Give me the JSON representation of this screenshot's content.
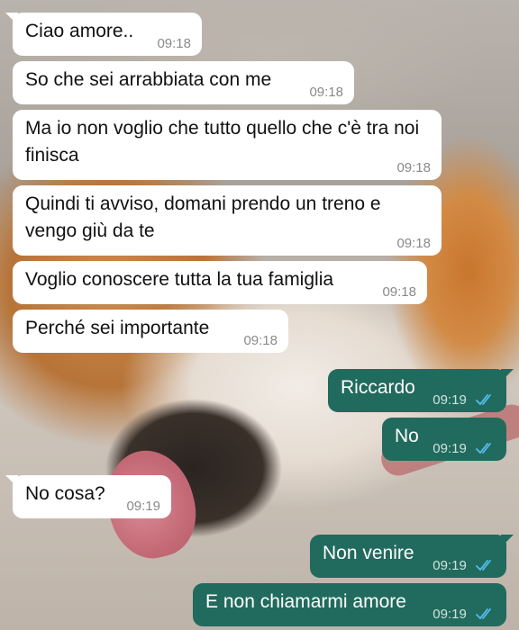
{
  "messages": [
    {
      "dir": "in",
      "text": "Ciao amore..",
      "time": "09:18"
    },
    {
      "dir": "in",
      "text": "So che sei arrabbiata con me",
      "time": "09:18"
    },
    {
      "dir": "in",
      "text": "Ma io non voglio che tutto quello che c'è tra noi finisca",
      "time": "09:18"
    },
    {
      "dir": "in",
      "text": "Quindi ti avviso, domani prendo un treno e vengo giù da te",
      "time": "09:18"
    },
    {
      "dir": "in",
      "text": "Voglio conoscere tutta la tua famiglia",
      "time": "09:18"
    },
    {
      "dir": "in",
      "text": "Perché sei importante",
      "time": "09:18"
    },
    {
      "dir": "out",
      "text": "Riccardo",
      "time": "09:19",
      "status": "read"
    },
    {
      "dir": "out",
      "text": "No",
      "time": "09:19",
      "status": "read"
    },
    {
      "dir": "in",
      "text": "No cosa?",
      "time": "09:19"
    },
    {
      "dir": "out",
      "text": "Non venire",
      "time": "09:19",
      "status": "read"
    },
    {
      "dir": "out",
      "text": "E non chiamarmi amore",
      "time": "09:19",
      "status": "read"
    }
  ],
  "colors": {
    "incoming_bubble": "#ffffff",
    "outgoing_bubble": "#216a5e",
    "read_tick": "#53bdeb"
  },
  "icons": {
    "read_status": "double-check-icon"
  }
}
